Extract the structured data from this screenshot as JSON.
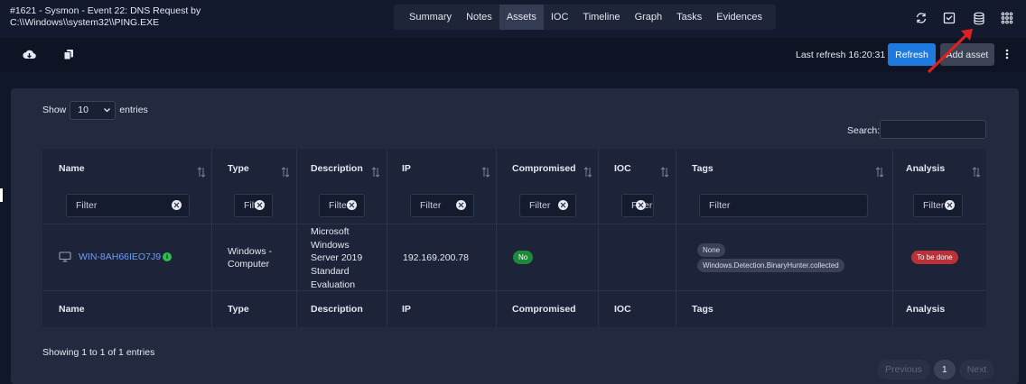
{
  "case": {
    "title_line1": "#1621 - Sysmon - Event 22: DNS Request by",
    "title_line2": "C:\\\\Windows\\\\system32\\\\PING.EXE"
  },
  "tabs": [
    "Summary",
    "Notes",
    "Assets",
    "IOC",
    "Timeline",
    "Graph",
    "Tasks",
    "Evidences"
  ],
  "active_tab": "Assets",
  "toolbar": {
    "last_refresh": "Last refresh 16:20:31",
    "refresh_label": "Refresh",
    "add_asset_label": "Add asset"
  },
  "table_controls": {
    "show_label": "Show",
    "page_length": "10",
    "entries_label": "entries",
    "search_label": "Search:"
  },
  "columns": [
    "Name",
    "Type",
    "Description",
    "IP",
    "Compromised",
    "IOC",
    "Tags",
    "Analysis"
  ],
  "filters": [
    "Filter",
    "Filter",
    "Filter",
    "Filter",
    "Filter",
    "Filter",
    "Filter",
    "Filter"
  ],
  "row": {
    "name": "WIN-8AH66IEO7J9",
    "type_line1": "Windows -",
    "type_line2": "Computer",
    "description": [
      "Microsoft",
      "Windows",
      "Server 2019",
      "Standard",
      "Evaluation"
    ],
    "ip": "192.169.200.78",
    "compromised": "No",
    "tags": [
      "None",
      "Windows.Detection.BinaryHunter.collected"
    ],
    "analysis": "To be done"
  },
  "footer": {
    "showing": "Showing 1 to 1 of 1 entries",
    "previous": "Previous",
    "page": "1",
    "next": "Next"
  },
  "colors": {
    "accent_blue": "#1f7ae0",
    "badge_green": "#1d8a3a",
    "badge_red": "#b9323a",
    "annotation_arrow": "#e02020"
  },
  "icons": {
    "top": [
      "sync-icon",
      "mail-check-icon",
      "database-icon",
      "grid-icon"
    ],
    "toolbar": [
      "cloud-download-icon",
      "copy-icon"
    ],
    "row": [
      "computer-icon",
      "info-icon"
    ]
  }
}
